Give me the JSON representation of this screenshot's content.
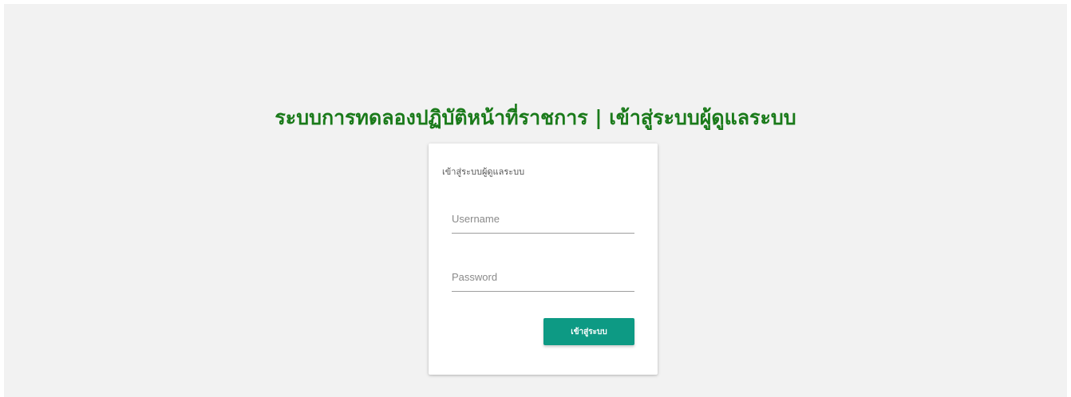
{
  "header": {
    "title": "ระบบการทดลองปฏิบัติหน้าที่ราชการ | เข้าสู่ระบบผู้ดูแลระบบ"
  },
  "login_card": {
    "heading": "เข้าสู่ระบบผู้ดูแลระบบ",
    "username": {
      "placeholder": "Username",
      "value": ""
    },
    "password": {
      "placeholder": "Password",
      "value": ""
    },
    "submit_label": "เข้าสู่ระบบ"
  },
  "colors": {
    "title": "#1a7a1a",
    "button": "#0d9a84",
    "background": "#f2f2f2"
  }
}
